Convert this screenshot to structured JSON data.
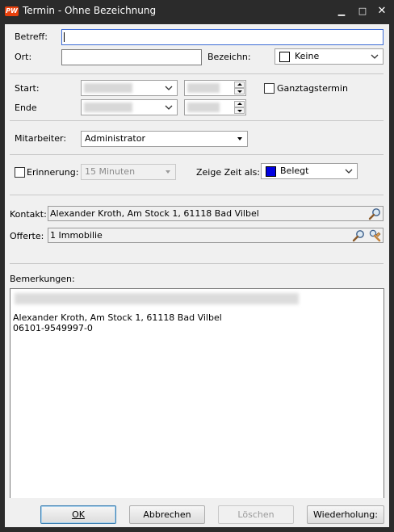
{
  "window": {
    "title": "Termin - Ohne Bezeichnung",
    "app_icon_text": "PW",
    "min_glyph": "▁",
    "max_glyph": "□",
    "close_glyph": "✕"
  },
  "form": {
    "betreff_label": "Betreff:",
    "betreff_value": "",
    "ort_label": "Ort:",
    "ort_value": "",
    "bezeichn_label": "Bezeichn:",
    "bezeichn_value": "Keine",
    "start_label": "Start:",
    "ende_label": "Ende",
    "ganztag_label": "Ganztagstermin",
    "mitarbeiter_label": "Mitarbeiter:",
    "mitarbeiter_value": "Administrator",
    "erinnerung_label": "Erinnerung:",
    "erinnerung_value": "15 Minuten",
    "zeige_zeit_label": "Zeige Zeit als:",
    "zeige_zeit_value": "Belegt",
    "zeige_zeit_color": "#0000e0",
    "kontakt_label": "Kontakt:",
    "kontakt_value": "Alexander Kroth, Am Stock 1, 61118 Bad Vilbel",
    "offerte_label": "Offerte:",
    "offerte_value": "1 Immobilie",
    "bemerkungen_label": "Bemerkungen:",
    "bemerkungen_lines": [
      "Alexander Kroth, Am Stock 1, 61118 Bad Vilbel",
      "06101-9549997-0"
    ]
  },
  "buttons": {
    "ok": "OK",
    "abbrechen": "Abbrechen",
    "loeschen": "Löschen",
    "wiederholung": "Wiederholung:"
  }
}
